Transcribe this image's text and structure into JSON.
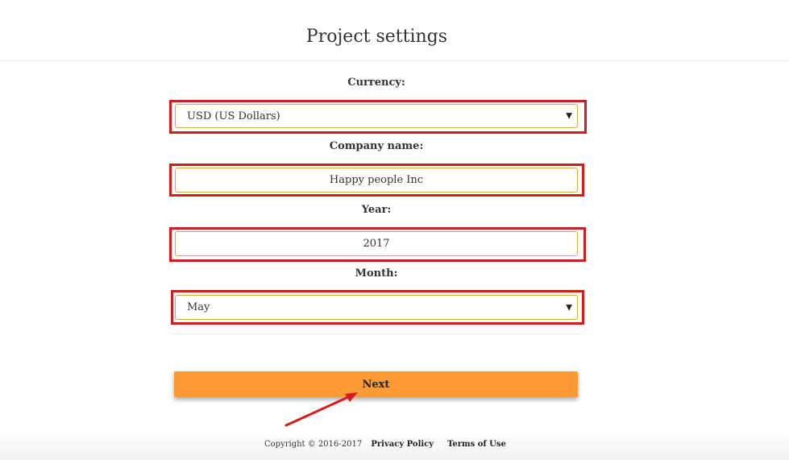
{
  "header": {
    "title": "Project settings"
  },
  "form": {
    "currency": {
      "label": "Currency:",
      "value": "USD (US Dollars)"
    },
    "company_name": {
      "label": "Company name:",
      "value": "Happy people Inc"
    },
    "year": {
      "label": "Year:",
      "value": "2017"
    },
    "month": {
      "label": "Month:",
      "value": "May"
    },
    "next_label": "Next"
  },
  "footer": {
    "copyright": "Copyright © 2016-2017",
    "privacy": "Privacy Policy",
    "terms": "Terms of Use"
  },
  "colors": {
    "highlight": "#cc1f1f",
    "field_border": "#d9a640",
    "button": "#fc9a35",
    "annotation_arrow": "#d81c1c"
  },
  "icons": {
    "select_arrow": "dropdown-caret-icon",
    "annotation": "red-arrow-icon"
  }
}
